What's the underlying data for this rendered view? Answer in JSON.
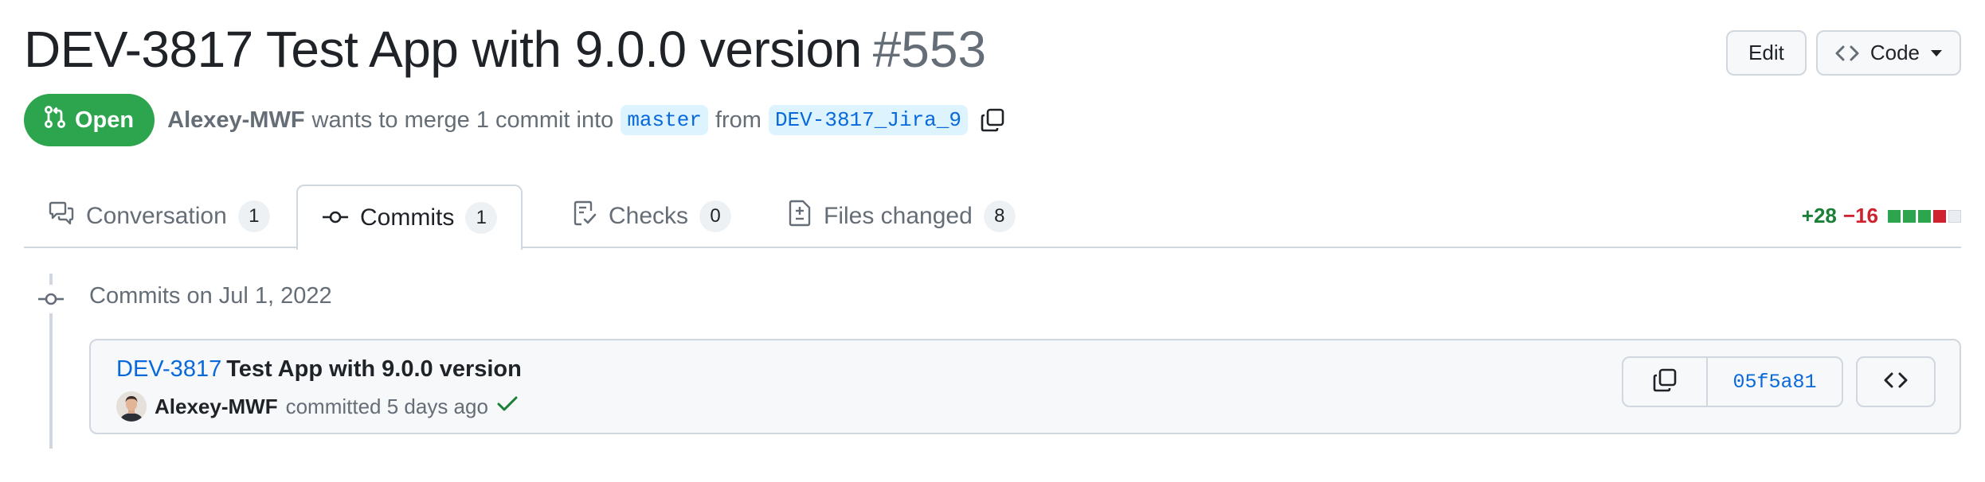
{
  "pr": {
    "title": "DEV-3817 Test App with 9.0.0 version",
    "number": "#553",
    "state": "Open",
    "author": "Alexey-MWF",
    "merge_text": "wants to merge 1 commit into",
    "base_branch": "master",
    "from_text": "from",
    "head_branch": "DEV-3817_Jira_9"
  },
  "header_actions": {
    "edit_label": "Edit",
    "code_label": "Code"
  },
  "tabs": [
    {
      "label": "Conversation",
      "count": "1",
      "icon": "comment-discussion-icon",
      "active": false
    },
    {
      "label": "Commits",
      "count": "1",
      "icon": "git-commit-icon",
      "active": true
    },
    {
      "label": "Checks",
      "count": "0",
      "icon": "checklist-icon",
      "active": false
    },
    {
      "label": "Files changed",
      "count": "8",
      "icon": "file-diff-icon",
      "active": false
    }
  ],
  "diffstat": {
    "additions": "+28",
    "deletions": "−16",
    "blocks": [
      "added",
      "added",
      "added",
      "deleted",
      "neutral"
    ],
    "colors": {
      "added": "#2da44e",
      "deleted": "#cf222e",
      "neutral": "#eaeef2"
    }
  },
  "timeline": {
    "date_heading": "Commits on Jul 1, 2022"
  },
  "commit": {
    "issue_link": "DEV-3817",
    "message": "Test App with 9.0.0 version",
    "author": "Alexey-MWF",
    "action_text": "committed 5 days ago",
    "status": "success",
    "sha": "05f5a81"
  },
  "colors": {
    "accent": "#0969da",
    "open_green": "#2da44e",
    "border": "#d0d7de",
    "muted_text": "#656d76"
  }
}
